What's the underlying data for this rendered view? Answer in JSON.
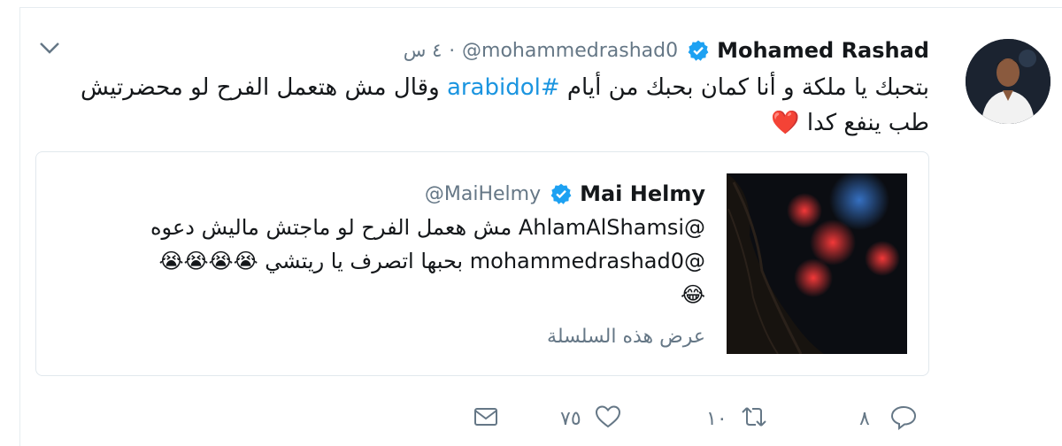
{
  "tweet": {
    "author_name": "Mohamed Rashad",
    "handle": "@mohammedrashad0",
    "separator": "·",
    "time": "٤ س",
    "text_before_hashtag": "بتحبك يا ملكة و أنا كمان بحبك من أيام ",
    "hashtag": "#arabidol",
    "text_after_hashtag": " وقال مش هتعمل الفرح لو محضرتيش طب ينفع كدا ",
    "heart_emoji": "❤️"
  },
  "quote": {
    "author_name": "Mai Helmy",
    "handle": "@MaiHelmy",
    "line1": "@AhlamAlShamsi مش هعمل الفرح لو ماجتش ماليش دعوه",
    "line2": "@mohammedrashad0 بحبها اتصرف يا ريتشي 😭😭😭😭",
    "line3": "😂",
    "show_thread": "عرض هذه السلسلة"
  },
  "actions": {
    "reply_count": "٨",
    "retweet_count": "١٠",
    "like_count": "٧٥"
  },
  "colors": {
    "accent": "#1b95e0",
    "secondary_text": "#657786",
    "border": "#e1e8ed"
  }
}
